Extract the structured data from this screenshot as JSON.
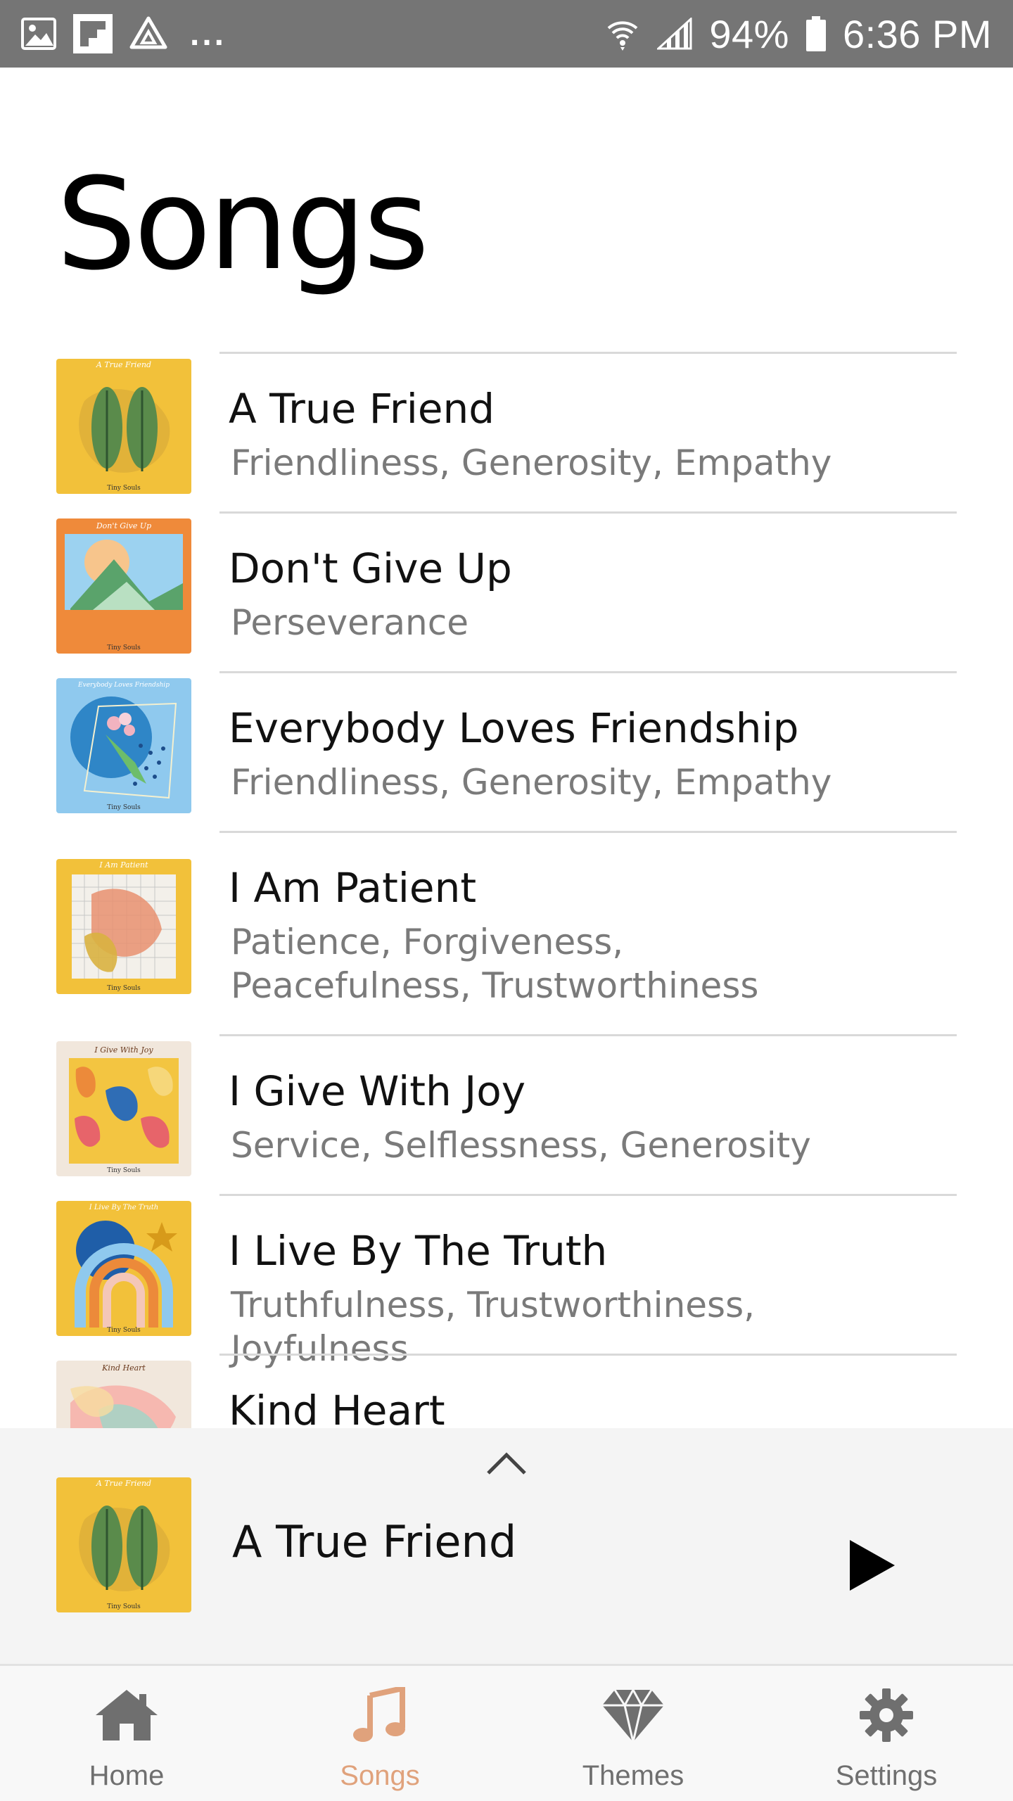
{
  "status_bar": {
    "battery": "94%",
    "time": "6:36 PM",
    "overflow": "..."
  },
  "page": {
    "title": "Songs"
  },
  "songs": [
    {
      "title": "A True Friend",
      "themes": "Friendliness, Generosity, Empathy",
      "art_label": "A True Friend",
      "art_footer": "Tiny Souls"
    },
    {
      "title": "Don't Give Up",
      "themes": "Perseverance",
      "art_label": "Don't Give Up",
      "art_footer": "Tiny Souls"
    },
    {
      "title": "Everybody Loves Friendship",
      "themes": "Friendliness, Generosity, Empathy",
      "art_label": "Everybody Loves Friendship",
      "art_footer": "Tiny Souls"
    },
    {
      "title": "I Am Patient",
      "themes": "Patience, Forgiveness, Peacefulness, Trustworthiness",
      "art_label": "I Am Patient",
      "art_footer": "Tiny Souls"
    },
    {
      "title": "I Give With Joy",
      "themes": "Service, Selflessness, Generosity",
      "art_label": "I Give With Joy",
      "art_footer": "Tiny Souls"
    },
    {
      "title": "I Live By The Truth",
      "themes": "Truthfulness, Trustworthiness, Joyfulness",
      "art_label": "I Live By The Truth",
      "art_footer": "Tiny Souls"
    },
    {
      "title": "Kind Heart",
      "themes": "",
      "art_label": "Kind Heart",
      "art_footer": ""
    }
  ],
  "player": {
    "title": "A True Friend",
    "art_label": "A True Friend",
    "art_footer": "Tiny Souls"
  },
  "tabs": [
    {
      "label": "Home",
      "icon": "home-icon",
      "active": false
    },
    {
      "label": "Songs",
      "icon": "music-note-icon",
      "active": true
    },
    {
      "label": "Themes",
      "icon": "diamond-icon",
      "active": false
    },
    {
      "label": "Settings",
      "icon": "gear-icon",
      "active": false
    }
  ],
  "colors": {
    "status_bar": "#757575",
    "accent": "#e0a27c",
    "muted_text": "#7a7a7a",
    "player_bg": "#f4f4f4",
    "tab_inactive": "#6f6f6f"
  }
}
